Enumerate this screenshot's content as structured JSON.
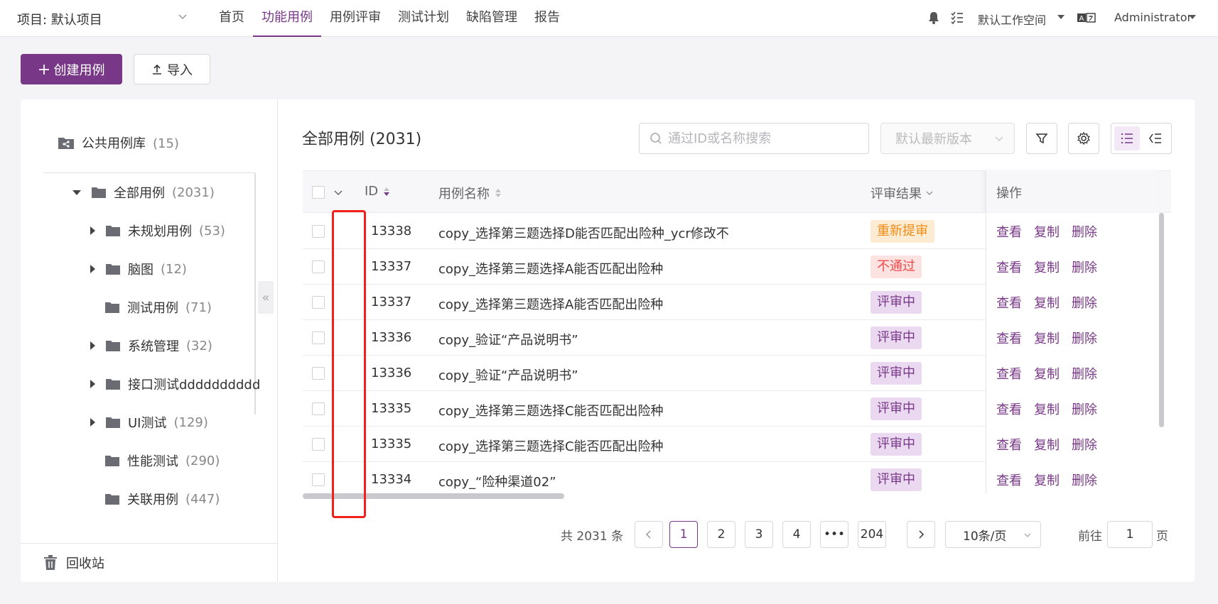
{
  "header": {
    "project": "项目: 默认项目",
    "nav": [
      "首页",
      "功能用例",
      "用例评审",
      "测试计划",
      "缺陷管理",
      "报告"
    ],
    "active_nav": "功能用例",
    "workspace": "默认工作空间",
    "user": "Administrator"
  },
  "toolbar": {
    "create_label": "创建用例",
    "import_label": "导入"
  },
  "left": {
    "public_lib": {
      "label": "公共用例库",
      "count": "(15)"
    },
    "tree": [
      {
        "label": "全部用例",
        "count": "(2031)",
        "arrow": "down",
        "level": 0
      },
      {
        "label": "未规划用例",
        "count": "(53)",
        "arrow": "right",
        "level": 1
      },
      {
        "label": "脑图",
        "count": "(12)",
        "arrow": "right",
        "level": 1
      },
      {
        "label": "测试用例",
        "count": "(71)",
        "arrow": "none",
        "level": 1
      },
      {
        "label": "系统管理",
        "count": "(32)",
        "arrow": "right",
        "level": 1
      },
      {
        "label": "接口测试dddddddddd",
        "count": "",
        "arrow": "right",
        "level": 1
      },
      {
        "label": "UI测试",
        "count": "(129)",
        "arrow": "right",
        "level": 1
      },
      {
        "label": "性能测试",
        "count": "(290)",
        "arrow": "none",
        "level": 1
      },
      {
        "label": "关联用例",
        "count": "(447)",
        "arrow": "none",
        "level": 1
      }
    ],
    "recycle": "回收站"
  },
  "main": {
    "title": "全部用例 (2031)",
    "search_placeholder": "通过ID或名称搜索",
    "version": "默认最新版本",
    "columns": {
      "id": "ID",
      "name": "用例名称",
      "review": "评审结果",
      "ops": "操作"
    },
    "rows": [
      {
        "id": "13338",
        "name": "copy_选择第三题选择D能否匹配出险种_ycr修改不",
        "review": "重新提审",
        "status": "resubmit"
      },
      {
        "id": "13337",
        "name": "copy_选择第三题选择A能否匹配出险种",
        "review": "不通过",
        "status": "fail"
      },
      {
        "id": "13337",
        "name": "copy_选择第三题选择A能否匹配出险种",
        "review": "评审中",
        "status": "review"
      },
      {
        "id": "13336",
        "name": "copy_验证“产品说明书”",
        "review": "评审中",
        "status": "review"
      },
      {
        "id": "13336",
        "name": "copy_验证“产品说明书”",
        "review": "评审中",
        "status": "review"
      },
      {
        "id": "13335",
        "name": "copy_选择第三题选择C能否匹配出险种",
        "review": "评审中",
        "status": "review"
      },
      {
        "id": "13335",
        "name": "copy_选择第三题选择C能否匹配出险种",
        "review": "评审中",
        "status": "review"
      },
      {
        "id": "13334",
        "name": "copy_“险种渠道02”",
        "review": "评审中",
        "status": "review"
      }
    ],
    "ops": [
      "查看",
      "复制",
      "删除"
    ]
  },
  "pagination": {
    "total": "共 2031 条",
    "pages": [
      "1",
      "2",
      "3",
      "4",
      "•••",
      "204"
    ],
    "current": "1",
    "page_size": "10条/页",
    "goto_label": "前往",
    "goto_value": "1",
    "page_suffix": "页"
  },
  "colors": {
    "accent": "#783887",
    "resubmit_bg": "#fdebd2",
    "resubmit_fg": "#f08c16",
    "fail_bg": "#fde2e2",
    "fail_fg": "#f24a4a",
    "review_bg": "#ead9f0",
    "review_fg": "#783887",
    "highlight_box": "#f2201c"
  }
}
